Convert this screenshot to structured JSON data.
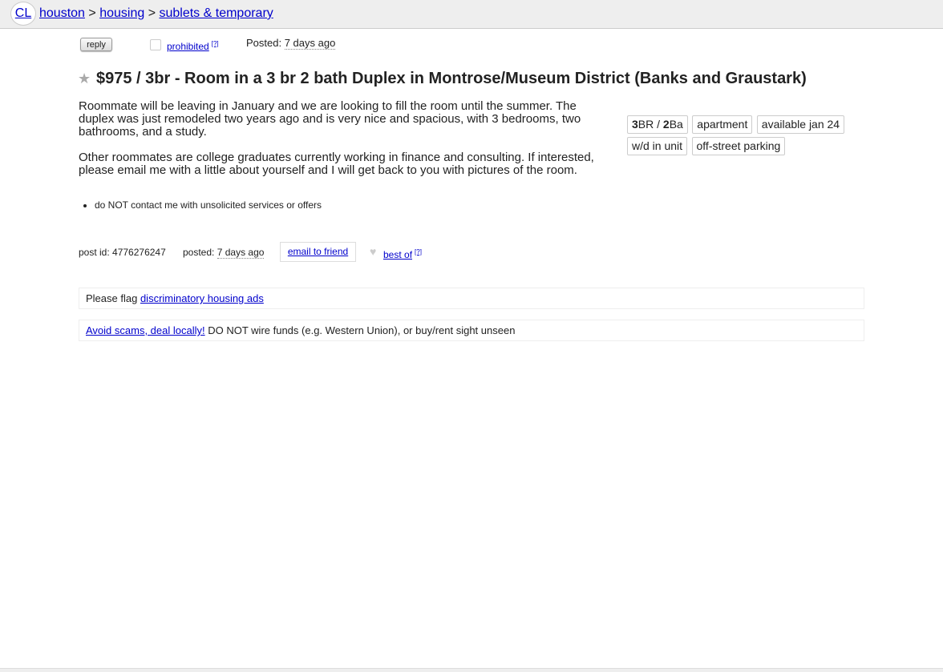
{
  "header": {
    "logo": "CL",
    "breadcrumbs": [
      "houston",
      "housing",
      "sublets & temporary"
    ],
    "separator": ">"
  },
  "actions": {
    "reply_label": "reply",
    "flag_label": "prohibited",
    "help_mark": "[?]",
    "posted_label": "Posted:",
    "posted_time": "7 days ago"
  },
  "posting": {
    "title": "$975 / 3br - Room in a 3 br 2 bath Duplex in Montrose/Museum District (Banks and Graustark)",
    "paragraphs": [
      "Roommate will be leaving in January and we are looking to fill the room until the summer. The duplex was just remodeled two years ago and is very nice and spacious, with 3 bedrooms, two bathrooms, and a study.",
      "Other roommates are college graduates currently working in finance and consulting. If interested, please email me with a little about yourself and I will get back to you with pictures of the room."
    ],
    "notices": [
      "do NOT contact me with unsolicited services or offers"
    ]
  },
  "attributes": {
    "br_count": "3",
    "br_unit": "BR / ",
    "ba_count": "2",
    "ba_unit": "Ba",
    "tags": [
      "apartment",
      "available jan 24",
      "w/d in unit",
      "off-street parking"
    ]
  },
  "postinfo": {
    "id_label": "post id: 4776276247",
    "posted_label": "posted:",
    "posted_time": "7 days ago",
    "email_label": "email to friend",
    "bestof_label": "best of",
    "help_mark": "[?]"
  },
  "notices_boxes": {
    "flag_prefix": "Please flag",
    "flag_link": "discriminatory housing ads",
    "scam_link": "Avoid scams, deal locally!",
    "scam_text": "DO NOT wire funds (e.g. Western Union), or buy/rent sight unseen"
  },
  "icons": {
    "star": "star-icon",
    "heart": "heart-icon"
  }
}
